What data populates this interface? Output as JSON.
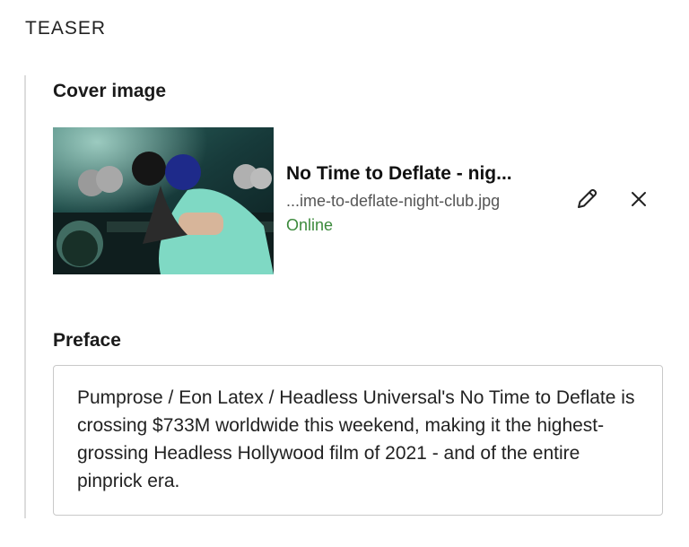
{
  "section": {
    "title": "TEASER"
  },
  "cover": {
    "label": "Cover image",
    "title": "No Time to Deflate - nig...",
    "filename": "...ime-to-deflate-night-club.jpg",
    "status": "Online",
    "status_color": "#3c8a3c",
    "edit_icon": "pencil-icon",
    "remove_icon": "close-icon"
  },
  "preface": {
    "label": "Preface",
    "value": "Pumprose / Eon Latex / Headless Universal's No Time to Deflate is crossing $733M worldwide this weekend, making it the highest-grossing Headless Hollywood film of 2021 - and of the entire pinprick era."
  }
}
